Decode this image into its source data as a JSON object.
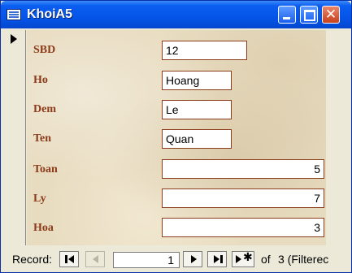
{
  "window": {
    "title": "KhoiA5",
    "controls": [
      "minimize",
      "maximize",
      "close"
    ],
    "close_glyph": "✕"
  },
  "record_selector": {
    "icon": "current-record-arrow-icon"
  },
  "form": {
    "fields": [
      {
        "label": "SBD",
        "value": "12"
      },
      {
        "label": "Ho",
        "value": "Hoang"
      },
      {
        "label": "Dem",
        "value": "Le"
      },
      {
        "label": "Ten",
        "value": "Quan"
      },
      {
        "label": "Toan",
        "value": "5"
      },
      {
        "label": "Ly",
        "value": "7"
      },
      {
        "label": "Hoa",
        "value": "3"
      }
    ],
    "label_color": "#8b3a1a"
  },
  "navigation": {
    "label": "Record:",
    "current": "1",
    "of_label": "of",
    "total_text": "3 (Filterec",
    "buttons": [
      "first-record",
      "previous-record",
      "next-record",
      "last-record",
      "new-record"
    ]
  },
  "colors": {
    "titlebar": "#0555e8",
    "close_button": "#c8401c",
    "form_background": "#e8dcc0"
  }
}
